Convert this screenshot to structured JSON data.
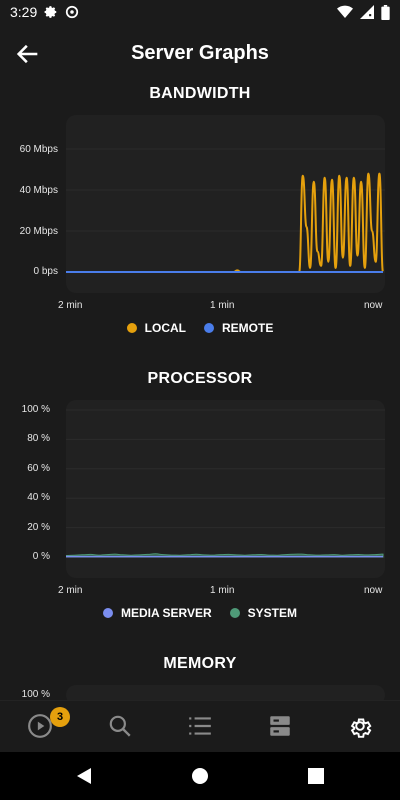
{
  "status_bar": {
    "time": "3:29",
    "icons": [
      "gear-icon",
      "at-sign-icon",
      "wifi-icon",
      "cellular-signal-icon",
      "battery-icon"
    ]
  },
  "header": {
    "title": "Server Graphs",
    "back_icon": "arrow-left-icon"
  },
  "colors": {
    "local": "#e5a00d",
    "remote": "#4a7dea",
    "media_server": "#7b8ef0",
    "system": "#4f9a78",
    "chart_bg": "#212121",
    "badge": "#e5a00d"
  },
  "bandwidth": {
    "title": "BANDWIDTH",
    "y_ticks": [
      "60 Mbps",
      "40 Mbps",
      "20 Mbps",
      "0 bps"
    ],
    "x_ticks": [
      "2 min",
      "1 min",
      "now"
    ],
    "legend": [
      {
        "label": "LOCAL",
        "color_key": "local"
      },
      {
        "label": "REMOTE",
        "color_key": "remote"
      }
    ]
  },
  "processor": {
    "title": "PROCESSOR",
    "y_ticks": [
      "100 %",
      "80 %",
      "60 %",
      "40 %",
      "20 %",
      "0 %"
    ],
    "x_ticks": [
      "2 min",
      "1 min",
      "now"
    ],
    "legend": [
      {
        "label": "MEDIA SERVER",
        "color_key": "media_server"
      },
      {
        "label": "SYSTEM",
        "color_key": "system"
      }
    ]
  },
  "memory": {
    "title": "MEMORY",
    "y_ticks": [
      "100 %"
    ]
  },
  "bottom_nav": {
    "items": [
      "play-icon",
      "search-icon",
      "list-icon",
      "server-icon",
      "settings-icon"
    ],
    "badge_count": "3"
  },
  "system_nav": {
    "items": [
      "back-triangle-icon",
      "home-circle-icon",
      "recents-square-icon"
    ]
  },
  "chart_data": [
    {
      "type": "line",
      "title": "BANDWIDTH",
      "x": [
        "2 min",
        "1 min",
        "now"
      ],
      "ylim": [
        0,
        60
      ],
      "y_unit": "Mbps",
      "series": [
        {
          "name": "LOCAL",
          "values": [
            0,
            0,
            0,
            0,
            0,
            0,
            0,
            0,
            0,
            0,
            0,
            0,
            0,
            0,
            0,
            0,
            0,
            0,
            0,
            0,
            0,
            0,
            0,
            0,
            0,
            0,
            0,
            0,
            0,
            0,
            0,
            0,
            0,
            0,
            0,
            0,
            0,
            0,
            0,
            0,
            0,
            0,
            0,
            0,
            0,
            0,
            0,
            0.8,
            0,
            0,
            0,
            0,
            0,
            0,
            0,
            0,
            0,
            0,
            0,
            0,
            0,
            0,
            0,
            0,
            0,
            47,
            22,
            2,
            44,
            10,
            3,
            46,
            5,
            45,
            2,
            47,
            7,
            46,
            3,
            46,
            8,
            44,
            2,
            48,
            20,
            5,
            48,
            0
          ]
        },
        {
          "name": "REMOTE",
          "values": [
            0,
            0,
            0,
            0,
            0,
            0,
            0,
            0,
            0,
            0,
            0,
            0,
            0,
            0,
            0,
            0,
            0,
            0,
            0,
            0,
            0,
            0,
            0,
            0,
            0,
            0,
            0,
            0,
            0,
            0,
            0,
            0,
            0,
            0,
            0,
            0,
            0,
            0,
            0,
            0,
            0,
            0,
            0,
            0,
            0,
            0,
            0,
            0,
            0,
            0,
            0,
            0,
            0,
            0,
            0,
            0,
            0,
            0,
            0,
            0,
            0,
            0,
            0,
            0,
            0,
            0,
            0,
            0,
            0,
            0,
            0,
            0,
            0,
            0,
            0,
            0,
            0,
            0,
            0,
            0,
            0,
            0,
            0,
            0,
            0,
            0,
            0,
            0
          ]
        }
      ]
    },
    {
      "type": "area",
      "title": "PROCESSOR",
      "x": [
        "2 min",
        "1 min",
        "now"
      ],
      "ylim": [
        0,
        100
      ],
      "y_unit": "%",
      "series": [
        {
          "name": "MEDIA SERVER",
          "values": [
            0.3,
            0.3,
            0.3,
            0.3,
            0.3,
            0.3,
            0.3,
            0.3,
            0.3,
            0.3,
            0.3,
            0.3,
            0.3,
            0.3,
            0.3,
            0.3,
            0.3,
            0.3,
            0.3,
            0.3,
            0.3,
            0.3,
            0.3,
            0.3,
            0.3,
            0.3,
            0.3,
            0.3,
            0.3,
            0.3,
            0.3,
            0.3,
            0.3,
            0.3,
            0.3,
            0.3,
            0.3,
            0.3,
            0.3,
            0.3
          ]
        },
        {
          "name": "SYSTEM",
          "values": [
            1.0,
            1.2,
            1.5,
            1.8,
            1.3,
            1.6,
            2.0,
            1.5,
            1.2,
            1.4,
            1.8,
            2.2,
            1.6,
            1.3,
            1.2,
            1.5,
            1.9,
            1.4,
            1.3,
            1.6,
            1.8,
            1.4,
            1.2,
            1.5,
            1.7,
            1.3,
            1.2,
            1.6,
            1.9,
            2.0,
            1.5,
            1.3,
            1.4,
            1.6,
            1.2,
            1.5,
            1.7,
            1.4,
            1.6,
            2.0
          ]
        }
      ]
    }
  ]
}
